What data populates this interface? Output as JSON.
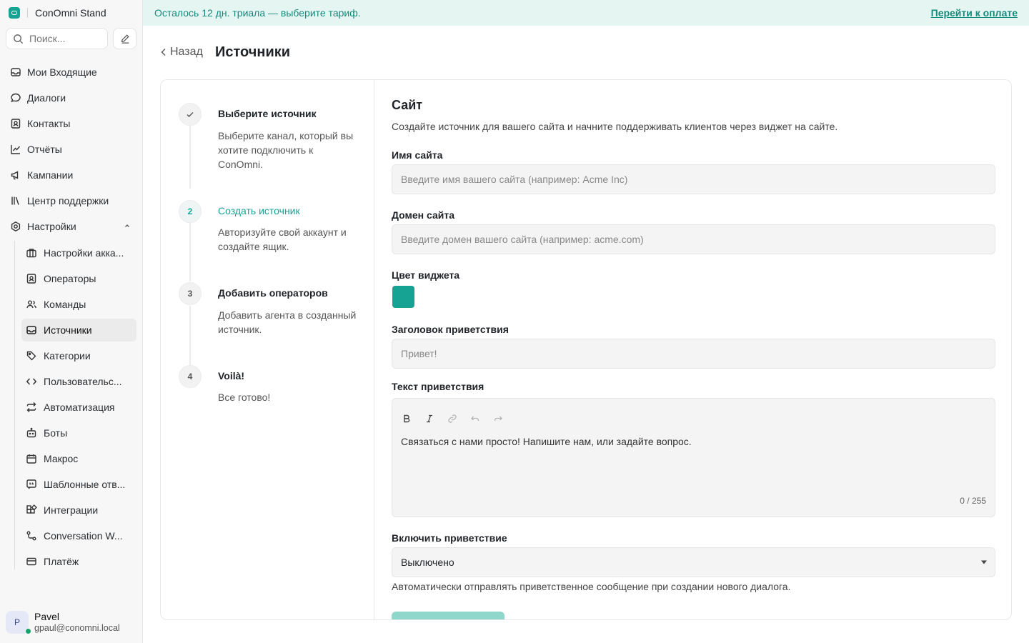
{
  "app": {
    "name": "ConOmni Stand"
  },
  "search": {
    "placeholder": "Поиск..."
  },
  "banner": {
    "text": "Осталось 12 дн. триала — выберите тариф.",
    "link": "Перейти к оплате"
  },
  "sidebar": {
    "items": [
      {
        "label": "Мои Входящие",
        "icon": "inbox-icon"
      },
      {
        "label": "Диалоги",
        "icon": "chat-bubble-icon"
      },
      {
        "label": "Контакты",
        "icon": "contact-card-icon"
      },
      {
        "label": "Отчёты",
        "icon": "line-chart-icon"
      },
      {
        "label": "Кампании",
        "icon": "megaphone-icon"
      },
      {
        "label": "Центр поддержки",
        "icon": "library-icon"
      },
      {
        "label": "Настройки",
        "icon": "settings-icon",
        "expanded": true
      }
    ],
    "settings_items": [
      {
        "label": "Настройки акка...",
        "icon": "briefcase-icon"
      },
      {
        "label": "Операторы",
        "icon": "contact-card-icon"
      },
      {
        "label": "Команды",
        "icon": "users-icon"
      },
      {
        "label": "Источники",
        "icon": "inbox-icon",
        "active": true
      },
      {
        "label": "Категории",
        "icon": "tag-icon"
      },
      {
        "label": "Пользовательс...",
        "icon": "code-icon"
      },
      {
        "label": "Автоматизация",
        "icon": "arrows-swap-icon"
      },
      {
        "label": "Боты",
        "icon": "bot-icon"
      },
      {
        "label": "Макрос",
        "icon": "calendar-icon"
      },
      {
        "label": "Шаблонные отв...",
        "icon": "quote-box-icon"
      },
      {
        "label": "Интеграции",
        "icon": "puzzle-icon"
      },
      {
        "label": "Conversation W...",
        "icon": "workflow-icon"
      },
      {
        "label": "Платёж",
        "icon": "credit-card-icon"
      }
    ]
  },
  "user": {
    "name": "Pavel",
    "email": "gpaul@conomni.local",
    "initial": "P",
    "status_color": "#16a36a"
  },
  "header": {
    "back": "Назад",
    "title": "Источники"
  },
  "steps": [
    {
      "marker": "✓",
      "title": "Выберите источник",
      "desc": "Выберите канал, который вы хотите подключить к ConOmni.",
      "state": "done"
    },
    {
      "marker": "2",
      "title": "Создать источник",
      "desc": "Авторизуйте свой аккаунт и создайте ящик.",
      "state": "current"
    },
    {
      "marker": "3",
      "title": "Добавить операторов",
      "desc": "Добавить агента в созданный источник.",
      "state": "pending"
    },
    {
      "marker": "4",
      "title": "Voilà!",
      "desc": "Все готово!",
      "state": "pending"
    }
  ],
  "form": {
    "title": "Сайт",
    "description": "Создайте источник для вашего сайта и начните поддерживать клиентов через виджет на сайте.",
    "site_name": {
      "label": "Имя сайта",
      "placeholder": "Введите имя вашего сайта (например: Acme Inc)",
      "value": ""
    },
    "site_domain": {
      "label": "Домен сайта",
      "placeholder": "Введите домен вашего сайта (например: acme.com)",
      "value": ""
    },
    "widget_color": {
      "label": "Цвет виджета",
      "value": "#16a394"
    },
    "greeting_title": {
      "label": "Заголовок приветствия",
      "placeholder": "Привет!",
      "value": ""
    },
    "greeting_text": {
      "label": "Текст приветствия",
      "value": "Связаться с нами просто! Напишите нам, или задайте вопрос.",
      "counter": "0 / 255"
    },
    "enable_greeting": {
      "label": "Включить приветствие",
      "value": "Выключено",
      "help": "Автоматически отправлять приветственное сообщение при создании нового диалога."
    }
  },
  "colors": {
    "accent": "#16a394",
    "banner_bg": "#e5f6f2",
    "submit_disabled": "#8fd6cb"
  }
}
